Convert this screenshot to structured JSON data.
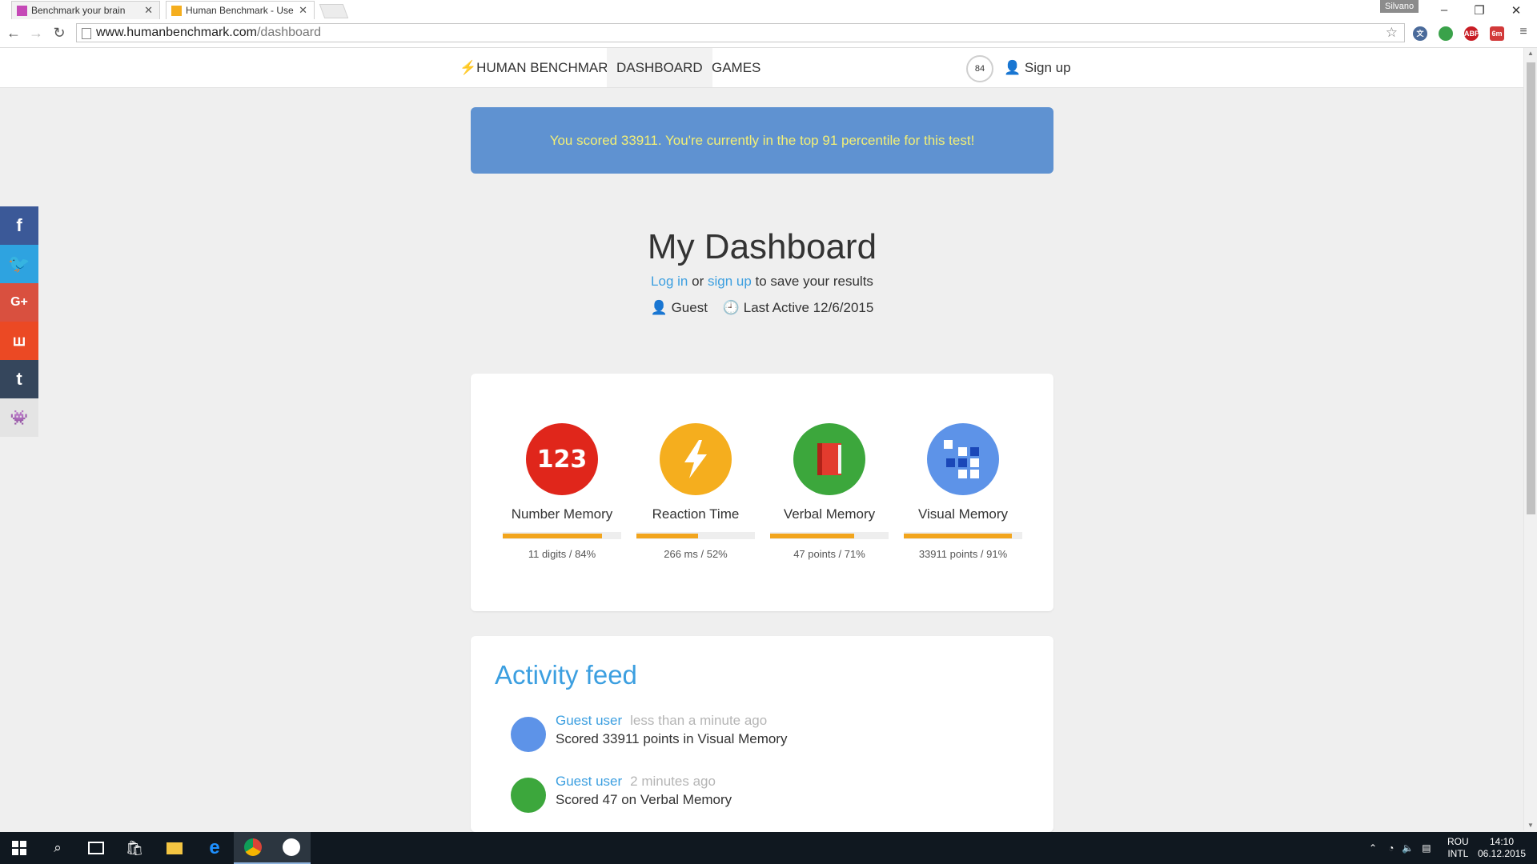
{
  "browser": {
    "tabs": [
      {
        "title": "Benchmark your brain"
      },
      {
        "title": "Human Benchmark - User"
      }
    ],
    "profile_name": "Silvano",
    "url_host": "www.humanbenchmark.com",
    "url_path": "/dashboard"
  },
  "nav": {
    "brand": "HUMAN BENCHMARK",
    "dashboard": "DASHBOARD",
    "games": "GAMES",
    "score_badge": "84",
    "signup": "Sign up"
  },
  "banner": {
    "text": "You scored 33911. You're currently in the top 91 percentile for this test!"
  },
  "dashboard": {
    "title": "My Dashboard",
    "login_link": "Log in",
    "or_text": "or",
    "signup_link": "sign up",
    "save_text": "to save your results",
    "user": "Guest",
    "last_active": "Last Active 12/6/2015"
  },
  "games": [
    {
      "name": "Number Memory",
      "icon_label": "123",
      "icon": "number-memory-icon",
      "color": "#e0261b",
      "stat": "11 digits / 84%",
      "percent": 84
    },
    {
      "name": "Reaction Time",
      "icon_label": "",
      "icon": "lightning-icon",
      "color": "#f5ae1e",
      "stat": "266 ms / 52%",
      "percent": 52
    },
    {
      "name": "Verbal Memory",
      "icon_label": "",
      "icon": "book-icon",
      "color": "#3ca73c",
      "stat": "47 points / 71%",
      "percent": 71
    },
    {
      "name": "Visual Memory",
      "icon_label": "",
      "icon": "grid-icon",
      "color": "#5d93e8",
      "stat": "33911 points / 91%",
      "percent": 91
    }
  ],
  "feed": {
    "title": "Activity feed",
    "items": [
      {
        "user": "Guest user",
        "time": "less than a minute ago",
        "text": "Scored 33911 points in Visual Memory",
        "color": "#5d93e8"
      },
      {
        "user": "Guest user",
        "time": "2 minutes ago",
        "text": "Scored 47 on Verbal Memory",
        "color": "#3ca73c"
      }
    ]
  },
  "social": [
    "facebook",
    "twitter",
    "google-plus",
    "stumbleupon",
    "tumblr",
    "reddit"
  ],
  "taskbar": {
    "lang": "ROU",
    "layout": "INTL",
    "time": "14:10",
    "date": "06.12.2015"
  }
}
